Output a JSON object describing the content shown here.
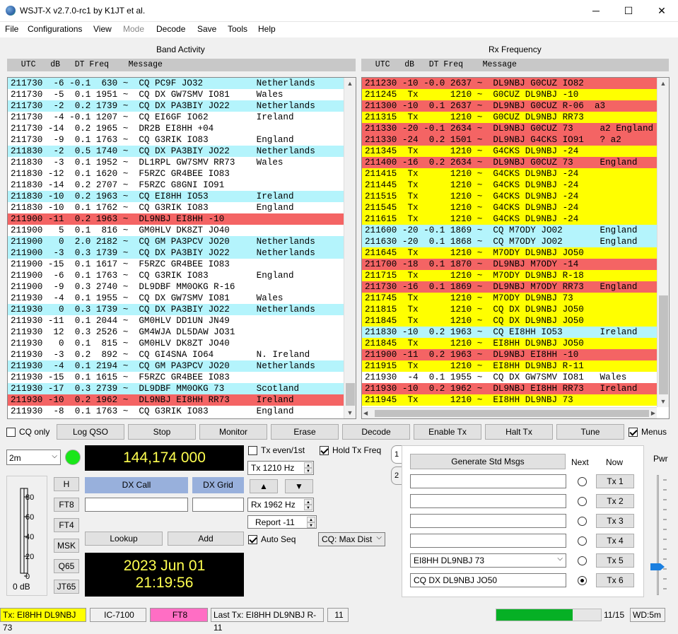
{
  "window": {
    "title": "WSJT-X   v2.7.0-rc1   by K1JT et al.",
    "minimize": "─",
    "maximize": "☐",
    "close": "✕"
  },
  "menu": [
    "File",
    "Configurations",
    "View",
    "Mode",
    "Decode",
    "Save",
    "Tools",
    "Help"
  ],
  "band_activity": {
    "title": "Band Activity",
    "header": "  UTC   dB   DT Freq    Message",
    "rows": [
      {
        "text": "211730  -6 -0.1  630 ~  CQ PC9F JO32          Netherlands",
        "bg": "#b4f4fc"
      },
      {
        "text": "211730  -5  0.1 1951 ~  CQ DX GW7SMV IO81     Wales",
        "bg": "#ffffff"
      },
      {
        "text": "211730  -2  0.2 1739 ~  CQ DX PA3BIY JO22     Netherlands",
        "bg": "#b4f4fc"
      },
      {
        "text": "211730  -4 -0.1 1207 ~  CQ EI6GF IO62         Ireland",
        "bg": "#ffffff"
      },
      {
        "text": "211730 -14  0.2 1965 ~  DR2B EI8HH +04",
        "bg": "#ffffff"
      },
      {
        "text": "211730  -9  0.1 1763 ~  CQ G3RIK IO83         England",
        "bg": "#ffffff"
      },
      {
        "text": "211830  -2  0.5 1740 ~  CQ DX PA3BIY JO22     Netherlands",
        "bg": "#b4f4fc"
      },
      {
        "text": "211830  -3  0.1 1952 ~  DL1RPL GW7SMV RR73    Wales",
        "bg": "#ffffff"
      },
      {
        "text": "211830 -12  0.1 1620 ~  F5RZC GR4BEE IO83",
        "bg": "#ffffff"
      },
      {
        "text": "211830 -14  0.2 2707 ~  F5RZC G8GNI IO91",
        "bg": "#ffffff"
      },
      {
        "text": "211830 -10  0.2 1963 ~  CQ EI8HH IO53         Ireland",
        "bg": "#b4f4fc"
      },
      {
        "text": "211830 -10  0.1 1762 ~  CQ G3RIK IO83         England",
        "bg": "#ffffff"
      },
      {
        "text": "211900 -11  0.2 1963 ~  DL9NBJ EI8HH -10",
        "bg": "#f46464"
      },
      {
        "text": "211900   5  0.1  816 ~  GM0HLV DK8ZT JO40",
        "bg": "#ffffff"
      },
      {
        "text": "211900   0  2.0 2182 ~  CQ GM PA3PCV JO20     Netherlands",
        "bg": "#b4f4fc"
      },
      {
        "text": "211900  -3  0.3 1739 ~  CQ DX PA3BIY JO22     Netherlands",
        "bg": "#b4f4fc"
      },
      {
        "text": "211900 -15  0.1 1617 ~  F5RZC GR4BEE IO83",
        "bg": "#ffffff"
      },
      {
        "text": "211900  -6  0.1 1763 ~  CQ G3RIK IO83         England",
        "bg": "#ffffff"
      },
      {
        "text": "211900  -9  0.3 2740 ~  DL9DBF MM0OKG R-16",
        "bg": "#ffffff"
      },
      {
        "text": "211930  -4  0.1 1955 ~  CQ DX GW7SMV IO81     Wales",
        "bg": "#ffffff"
      },
      {
        "text": "211930   0  0.3 1739 ~  CQ DX PA3BIY JO22     Netherlands",
        "bg": "#b4f4fc"
      },
      {
        "text": "211930 -11  0.1 2044 ~  GM0HLV DD1UN JN49",
        "bg": "#ffffff"
      },
      {
        "text": "211930  12  0.3 2526 ~  GM4WJA DL5DAW JO31",
        "bg": "#ffffff"
      },
      {
        "text": "211930   0  0.1  815 ~  GM0HLV DK8ZT JO40",
        "bg": "#ffffff"
      },
      {
        "text": "211930  -3  0.2  892 ~  CQ GI4SNA IO64        N. Ireland",
        "bg": "#ffffff"
      },
      {
        "text": "211930  -4  0.1 2194 ~  CQ GM PA3PCV JO20     Netherlands",
        "bg": "#b4f4fc"
      },
      {
        "text": "211930 -15  0.1 1615 ~  F5RZC GR4BEE IO83",
        "bg": "#ffffff"
      },
      {
        "text": "211930 -17  0.3 2739 ~  DL9DBF MM0OKG 73      Scotland",
        "bg": "#b4f4fc"
      },
      {
        "text": "211930 -10  0.2 1962 ~  DL9NBJ EI8HH RR73     Ireland",
        "bg": "#f46464"
      },
      {
        "text": "211930  -8  0.1 1763 ~  CQ G3RIK IO83         England",
        "bg": "#ffffff"
      }
    ]
  },
  "rx_frequency": {
    "title": "Rx Frequency",
    "header": "  UTC   dB   DT Freq    Message",
    "rows": [
      {
        "text": "211230 -10 -0.0 2637 ~  DL9NBJ G0CUZ IO82",
        "bg": "#f46464"
      },
      {
        "text": "211245  Tx      1210 ~  G0CUZ DL9NBJ -10",
        "bg": "#ffff00"
      },
      {
        "text": "211300 -10  0.1 2637 ~  DL9NBJ G0CUZ R-06  a3",
        "bg": "#f46464"
      },
      {
        "text": "211315  Tx      1210 ~  G0CUZ DL9NBJ RR73",
        "bg": "#ffff00"
      },
      {
        "text": "211330 -20 -0.1 2634 ~  DL9NBJ G0CUZ 73     a2 England",
        "bg": "#f46464"
      },
      {
        "text": "211330 -24  0.2 1501 ~  DL9NBJ G4CKS IO91   ? a2",
        "bg": "#f46464"
      },
      {
        "text": "211345  Tx      1210 ~  G4CKS DL9NBJ -24",
        "bg": "#ffff00"
      },
      {
        "text": "211400 -16  0.2 2634 ~  DL9NBJ G0CUZ 73     England",
        "bg": "#f46464"
      },
      {
        "text": "211415  Tx      1210 ~  G4CKS DL9NBJ -24",
        "bg": "#ffff00"
      },
      {
        "text": "211445  Tx      1210 ~  G4CKS DL9NBJ -24",
        "bg": "#ffff00"
      },
      {
        "text": "211515  Tx      1210 ~  G4CKS DL9NBJ -24",
        "bg": "#ffff00"
      },
      {
        "text": "211545  Tx      1210 ~  G4CKS DL9NBJ -24",
        "bg": "#ffff00"
      },
      {
        "text": "211615  Tx      1210 ~  G4CKS DL9NBJ -24",
        "bg": "#ffff00"
      },
      {
        "text": "211600 -20 -0.1 1869 ~  CQ M7ODY JO02       England",
        "bg": "#b4f4fc"
      },
      {
        "text": "211630 -20  0.1 1868 ~  CQ M7ODY JO02       England",
        "bg": "#b4f4fc"
      },
      {
        "text": "211645  Tx      1210 ~  M7ODY DL9NBJ JO50",
        "bg": "#ffff00"
      },
      {
        "text": "211700 -18  0.1 1870 ~  DL9NBJ M7ODY -14",
        "bg": "#f46464"
      },
      {
        "text": "211715  Tx      1210 ~  M7ODY DL9NBJ R-18",
        "bg": "#ffff00"
      },
      {
        "text": "211730 -16  0.1 1869 ~  DL9NBJ M7ODY RR73   England",
        "bg": "#f46464"
      },
      {
        "text": "211745  Tx      1210 ~  M7ODY DL9NBJ 73",
        "bg": "#ffff00"
      },
      {
        "text": "211815  Tx      1210 ~  CQ DX DL9NBJ JO50",
        "bg": "#ffff00"
      },
      {
        "text": "211845  Tx      1210 ~  CQ DX DL9NBJ JO50",
        "bg": "#ffff00"
      },
      {
        "text": "211830 -10  0.2 1963 ~  CQ EI8HH IO53       Ireland",
        "bg": "#b4f4fc"
      },
      {
        "text": "211845  Tx      1210 ~  EI8HH DL9NBJ JO50",
        "bg": "#ffff00"
      },
      {
        "text": "211900 -11  0.2 1963 ~  DL9NBJ EI8HH -10",
        "bg": "#f46464"
      },
      {
        "text": "211915  Tx      1210 ~  EI8HH DL9NBJ R-11",
        "bg": "#ffff00"
      },
      {
        "text": "211930  -4  0.1 1955 ~  CQ DX GW7SMV IO81   Wales",
        "bg": "#ffffff"
      },
      {
        "text": "211930 -10  0.2 1962 ~  DL9NBJ EI8HH RR73   Ireland",
        "bg": "#f46464"
      },
      {
        "text": "211945  Tx      1210 ~  EI8HH DL9NBJ 73",
        "bg": "#ffff00"
      }
    ]
  },
  "controls": {
    "cq_only": "CQ only",
    "log_qso": "Log QSO",
    "stop": "Stop",
    "monitor": "Monitor",
    "erase": "Erase",
    "decode": "Decode",
    "enable_tx": "Enable Tx",
    "halt_tx": "Halt Tx",
    "tune": "Tune",
    "menus": "Menus"
  },
  "band": "2m",
  "frequency": "144,174 000",
  "tx_even": "Tx even/1st",
  "hold_tx": "Hold Tx Freq",
  "tx_freq": "Tx  1210  Hz",
  "rx_freq": "Rx  1962  Hz",
  "report": "Report -11",
  "auto_seq": "Auto Seq",
  "cq_mode": "CQ: Max Dist",
  "dx_call_label": "DX Call",
  "dx_grid_label": "DX Grid",
  "dx_call_value": "",
  "dx_grid_value": "",
  "lookup": "Lookup",
  "add": "Add",
  "date": "2023 Jun 01",
  "time": "21:19:56",
  "modes": [
    "H",
    "FT8",
    "FT4",
    "MSK",
    "Q65",
    "JT65"
  ],
  "meter": {
    "ticks": [
      "80",
      "60",
      "40",
      "20",
      "0"
    ],
    "label": "0 dB"
  },
  "tabs": [
    "1",
    "2"
  ],
  "gen_std": "Generate Std Msgs",
  "next": "Next",
  "now": "Now",
  "tx_msgs": [
    {
      "text": "",
      "btn": "Tx 1"
    },
    {
      "text": "",
      "btn": "Tx 2"
    },
    {
      "text": "",
      "btn": "Tx 3"
    },
    {
      "text": "",
      "btn": "Tx 4"
    },
    {
      "text": "EI8HH DL9NBJ 73",
      "btn": "Tx 5"
    },
    {
      "text": "CQ DX DL9NBJ JO50",
      "btn": "Tx 6"
    }
  ],
  "pwr": "Pwr",
  "status": {
    "tx": "Tx: EI8HH DL9NBJ 73",
    "rig": "IC-7100",
    "mode": "FT8",
    "last_tx": "Last Tx: EI8HH DL9NBJ R-11",
    "count": "11",
    "progress": 0.73,
    "seq": "11/15",
    "wd": "WD:5m"
  }
}
